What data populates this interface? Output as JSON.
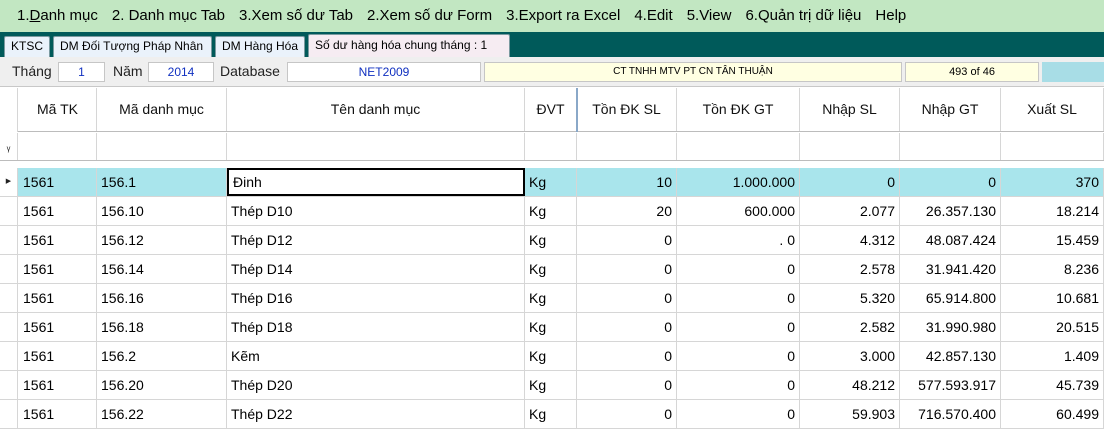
{
  "menu": [
    "1.Danh mục",
    "2. Danh mục Tab",
    "3.Xem số dư Tab",
    "2.Xem số dư Form",
    "3.Export ra Excel",
    "4.Edit",
    "5.View",
    "6.Quản trị dữ liệu",
    "Help"
  ],
  "tabs": [
    "KTSC",
    "DM Đối Tượng Pháp Nhân",
    "DM Hàng Hóa",
    "Số dư hàng hóa chung tháng : 1"
  ],
  "filter": {
    "month_label": "Tháng",
    "month": "1",
    "year_label": "Năm",
    "year": "2014",
    "db_label": "Database",
    "db": "NET2009",
    "company": "CT TNHH MTV PT CN TÂN THUẬN",
    "record_count": "493 of 46"
  },
  "columns": [
    "Mã TK",
    "Mã danh mục",
    "Tên danh mục",
    "ĐVT",
    "Tồn ĐK SL",
    "Tồn ĐK GT",
    "Nhập SL",
    "Nhập GT",
    "Xuất SL"
  ],
  "filter_row_icon": "funnel-icon",
  "current_row_icon": "triangle-right-icon",
  "rows": [
    [
      "1561",
      "156.1",
      "Đinh",
      "Kg",
      "10",
      "1.000.000",
      "0",
      "0",
      "370"
    ],
    [
      "1561",
      "156.10",
      "Thép D10",
      "Kg",
      "20",
      "600.000",
      "2.077",
      "26.357.130",
      "18.214"
    ],
    [
      "1561",
      "156.12",
      "Thép D12",
      "Kg",
      "0",
      ".          0",
      "4.312",
      "48.087.424",
      "15.459"
    ],
    [
      "1561",
      "156.14",
      "Thép D14",
      "Kg",
      "0",
      "0",
      "2.578",
      "31.941.420",
      "8.236"
    ],
    [
      "1561",
      "156.16",
      "Thép D16",
      "Kg",
      "0",
      "0",
      "5.320",
      "65.914.800",
      "10.681"
    ],
    [
      "1561",
      "156.18",
      "Thép D18",
      "Kg",
      "0",
      "0",
      "2.582",
      "31.990.980",
      "20.515"
    ],
    [
      "1561",
      "156.2",
      "Kẽm",
      "Kg",
      "0",
      "0",
      "3.000",
      "42.857.130",
      "1.409"
    ],
    [
      "1561",
      "156.20",
      "Thép D20",
      "Kg",
      "0",
      "0",
      "48.212",
      "577.593.917",
      "45.739"
    ],
    [
      "1561",
      "156.22",
      "Thép D22",
      "Kg",
      "0",
      "0",
      "59.903",
      "716.570.400",
      "60.499"
    ]
  ]
}
